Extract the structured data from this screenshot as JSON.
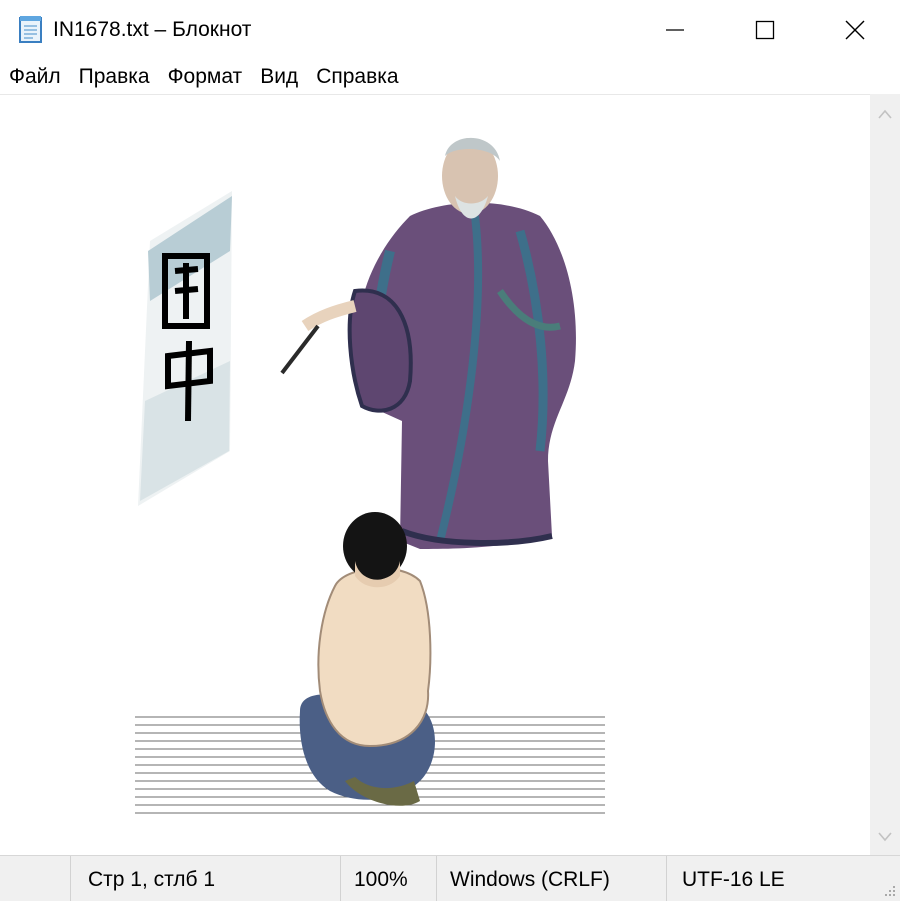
{
  "window": {
    "title": "IN1678.txt – Блокнот",
    "app_icon": "notepad-icon"
  },
  "controls": {
    "minimize_icon": "minimize-icon",
    "maximize_icon": "maximize-icon",
    "close_icon": "close-icon"
  },
  "menu": {
    "items": [
      {
        "label": "Файл"
      },
      {
        "label": "Правка"
      },
      {
        "label": "Формат"
      },
      {
        "label": "Вид"
      },
      {
        "label": "Справка"
      }
    ]
  },
  "editor": {
    "content_description_icon": "ascii-art-teacher-student",
    "scroll_up_icon": "chevron-up-icon",
    "scroll_down_icon": "chevron-down-icon"
  },
  "status": {
    "position": "Стр 1, стлб 1",
    "zoom": "100%",
    "line_endings": "Windows (CRLF)",
    "encoding": "UTF-16 LE"
  },
  "colors": {
    "robe": "#6a4f7a",
    "robe_trim": "#3e6f8a",
    "skin": "#f1dcc2",
    "hair": "#141414",
    "pants": "#4b5f86",
    "scroll": "#9fb9c4"
  }
}
